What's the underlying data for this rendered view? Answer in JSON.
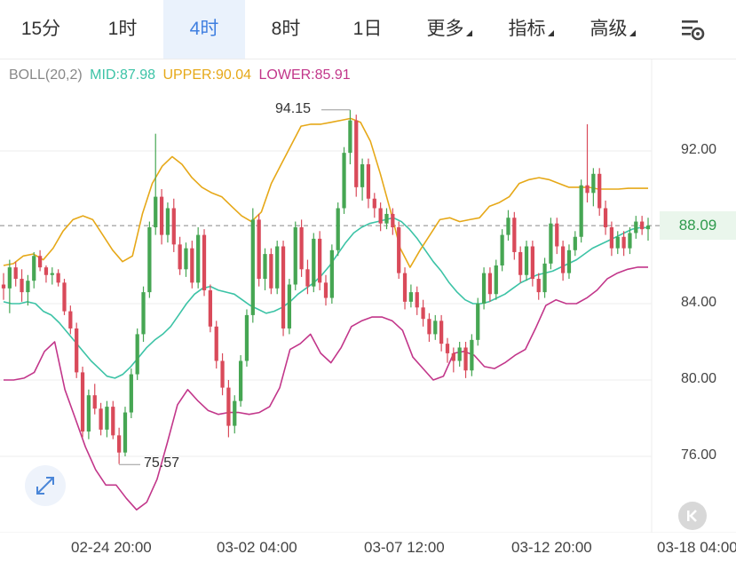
{
  "tabs": [
    {
      "label": "15分",
      "active": false,
      "dropdown": false
    },
    {
      "label": "1时",
      "active": false,
      "dropdown": false
    },
    {
      "label": "4时",
      "active": true,
      "dropdown": false
    },
    {
      "label": "8时",
      "active": false,
      "dropdown": false
    },
    {
      "label": "1日",
      "active": false,
      "dropdown": false
    },
    {
      "label": "更多",
      "active": false,
      "dropdown": true
    },
    {
      "label": "指标",
      "active": false,
      "dropdown": true
    },
    {
      "label": "高级",
      "active": false,
      "dropdown": true
    }
  ],
  "toolbar": {
    "settings_icon": "chart-settings-icon"
  },
  "indicator": {
    "name": "BOLL(20,2)",
    "mid": "MID:87.98",
    "upper": "UPPER:90.04",
    "lower": "LOWER:85.91",
    "colors": {
      "name": "#888888",
      "mid": "#3cc3a6",
      "upper": "#e6a818",
      "lower": "#c2368a"
    }
  },
  "price_axis": [
    "92.00",
    "88.09",
    "84.00",
    "80.00",
    "76.00"
  ],
  "last_price": "88.09",
  "time_axis": [
    "02-24 20:00",
    "03-02 04:00",
    "03-07 12:00",
    "03-12 20:00",
    "03-18 04:00"
  ],
  "high_label": "94.15",
  "low_label": "75.57",
  "buttons": {
    "expand_icon": "expand-icon",
    "reset_icon": "chevron-left-icon"
  },
  "chart_data": {
    "type": "candlestick",
    "ylim": [
      73,
      97
    ],
    "yticks": [
      76,
      80,
      84,
      88,
      92
    ],
    "xlabels": [
      "02-24 20:00",
      "03-02 04:00",
      "03-07 12:00",
      "03-12 20:00",
      "03-18 04:00"
    ],
    "up_color": "#46a653",
    "down_color": "#d94a5a",
    "last_price": 88.09,
    "high": 94.15,
    "low": 75.57,
    "candles": [
      [
        85.0,
        85.6,
        84.2,
        84.8
      ],
      [
        84.8,
        86.3,
        83.5,
        85.9
      ],
      [
        85.9,
        86.2,
        84.9,
        85.3
      ],
      [
        85.3,
        85.8,
        84.1,
        84.6
      ],
      [
        84.6,
        85.5,
        83.9,
        85.2
      ],
      [
        85.2,
        86.7,
        84.8,
        86.5
      ],
      [
        86.5,
        86.8,
        85.7,
        85.9
      ],
      [
        85.9,
        86.0,
        85.1,
        85.5
      ],
      [
        85.5,
        85.9,
        85.0,
        85.6
      ],
      [
        85.6,
        85.8,
        84.9,
        85.1
      ],
      [
        85.1,
        85.3,
        83.4,
        83.6
      ],
      [
        83.6,
        83.9,
        82.4,
        82.7
      ],
      [
        82.7,
        83.0,
        80.1,
        80.4
      ],
      [
        80.4,
        80.7,
        77.0,
        77.3
      ],
      [
        77.3,
        79.5,
        76.9,
        79.2
      ],
      [
        79.2,
        79.8,
        78.2,
        78.5
      ],
      [
        78.5,
        78.8,
        77.1,
        77.4
      ],
      [
        77.4,
        78.9,
        77.0,
        78.6
      ],
      [
        78.6,
        78.9,
        76.9,
        77.1
      ],
      [
        77.1,
        77.5,
        75.6,
        76.2
      ],
      [
        76.2,
        78.6,
        76.0,
        78.3
      ],
      [
        78.3,
        80.6,
        78.0,
        80.3
      ],
      [
        80.3,
        82.7,
        80.0,
        82.4
      ],
      [
        82.4,
        84.9,
        82.0,
        84.6
      ],
      [
        84.6,
        88.3,
        84.3,
        88.0
      ],
      [
        88.0,
        92.9,
        87.6,
        89.6
      ],
      [
        89.6,
        90.0,
        87.1,
        87.6
      ],
      [
        87.6,
        89.3,
        87.2,
        89.0
      ],
      [
        89.0,
        89.5,
        86.7,
        87.1
      ],
      [
        87.1,
        87.5,
        85.5,
        85.8
      ],
      [
        85.8,
        87.2,
        85.4,
        86.9
      ],
      [
        86.9,
        87.3,
        84.8,
        85.1
      ],
      [
        85.1,
        88.0,
        84.8,
        87.6
      ],
      [
        87.6,
        87.9,
        84.4,
        84.7
      ],
      [
        84.7,
        85.0,
        82.5,
        82.8
      ],
      [
        82.8,
        83.1,
        80.6,
        81.0
      ],
      [
        81.0,
        81.4,
        79.2,
        79.6
      ],
      [
        79.6,
        80.0,
        77.0,
        77.6
      ],
      [
        77.6,
        79.2,
        77.2,
        78.9
      ],
      [
        78.9,
        81.3,
        78.6,
        81.0
      ],
      [
        81.0,
        83.7,
        80.7,
        83.4
      ],
      [
        83.4,
        89.0,
        83.0,
        88.4
      ],
      [
        88.4,
        88.7,
        84.9,
        85.3
      ],
      [
        85.3,
        86.9,
        84.7,
        86.6
      ],
      [
        86.6,
        86.9,
        84.5,
        84.8
      ],
      [
        84.8,
        87.3,
        84.5,
        87.0
      ],
      [
        87.0,
        87.3,
        82.3,
        82.7
      ],
      [
        82.7,
        85.3,
        82.4,
        85.0
      ],
      [
        85.0,
        88.3,
        84.7,
        88.0
      ],
      [
        88.0,
        88.4,
        85.4,
        85.8
      ],
      [
        85.8,
        86.3,
        84.5,
        84.9
      ],
      [
        84.9,
        87.7,
        84.6,
        87.4
      ],
      [
        87.4,
        87.8,
        84.7,
        85.1
      ],
      [
        85.1,
        85.5,
        83.9,
        84.3
      ],
      [
        84.3,
        87.1,
        84.0,
        86.8
      ],
      [
        86.8,
        89.3,
        86.5,
        89.0
      ],
      [
        89.0,
        92.2,
        88.7,
        91.9
      ],
      [
        91.9,
        94.15,
        91.3,
        93.6
      ],
      [
        93.6,
        93.9,
        89.6,
        90.1
      ],
      [
        90.1,
        91.6,
        89.4,
        91.3
      ],
      [
        91.3,
        91.6,
        89.0,
        89.5
      ],
      [
        89.5,
        89.8,
        88.5,
        89.0
      ],
      [
        89.0,
        89.3,
        87.8,
        88.2
      ],
      [
        88.2,
        89.0,
        87.9,
        88.7
      ],
      [
        88.7,
        89.0,
        87.6,
        88.0
      ],
      [
        88.0,
        88.3,
        85.3,
        85.6
      ],
      [
        85.6,
        85.9,
        83.7,
        84.1
      ],
      [
        84.1,
        85.0,
        83.8,
        84.6
      ],
      [
        84.6,
        84.9,
        83.4,
        83.8
      ],
      [
        83.8,
        84.2,
        82.8,
        83.2
      ],
      [
        83.2,
        83.5,
        82.0,
        82.4
      ],
      [
        82.4,
        83.4,
        82.1,
        83.1
      ],
      [
        83.1,
        83.4,
        81.5,
        81.9
      ],
      [
        81.9,
        82.2,
        80.9,
        81.4
      ],
      [
        81.4,
        81.7,
        80.4,
        81.0
      ],
      [
        81.0,
        82.0,
        80.7,
        81.7
      ],
      [
        81.7,
        82.0,
        80.1,
        80.5
      ],
      [
        80.5,
        82.4,
        80.2,
        82.1
      ],
      [
        82.1,
        84.3,
        81.8,
        84.0
      ],
      [
        84.0,
        85.9,
        83.7,
        85.6
      ],
      [
        85.6,
        85.9,
        84.1,
        84.5
      ],
      [
        84.5,
        86.3,
        84.2,
        86.0
      ],
      [
        86.0,
        87.9,
        85.7,
        87.6
      ],
      [
        87.6,
        88.9,
        87.3,
        88.5
      ],
      [
        88.5,
        88.8,
        86.3,
        86.7
      ],
      [
        86.7,
        87.0,
        85.1,
        85.5
      ],
      [
        85.5,
        87.3,
        85.2,
        87.0
      ],
      [
        87.0,
        87.3,
        84.9,
        85.3
      ],
      [
        85.3,
        85.6,
        84.2,
        84.6
      ],
      [
        84.6,
        86.4,
        84.3,
        86.1
      ],
      [
        86.1,
        88.5,
        85.8,
        88.2
      ],
      [
        88.2,
        88.5,
        86.6,
        87.0
      ],
      [
        87.0,
        87.3,
        85.2,
        85.6
      ],
      [
        85.6,
        87.1,
        85.3,
        86.8
      ],
      [
        86.8,
        87.8,
        86.5,
        87.5
      ],
      [
        87.5,
        90.5,
        87.2,
        90.2
      ],
      [
        90.2,
        93.4,
        89.3,
        89.8
      ],
      [
        89.8,
        91.1,
        89.1,
        90.8
      ],
      [
        90.8,
        91.1,
        88.6,
        89.0
      ],
      [
        89.0,
        89.4,
        87.6,
        88.0
      ],
      [
        88.0,
        88.3,
        86.5,
        86.9
      ],
      [
        86.9,
        87.8,
        86.6,
        87.5
      ],
      [
        87.5,
        87.8,
        86.5,
        86.9
      ],
      [
        86.9,
        88.0,
        86.6,
        87.7
      ],
      [
        87.7,
        88.6,
        87.4,
        88.3
      ],
      [
        88.3,
        88.6,
        87.6,
        87.9
      ],
      [
        87.9,
        88.5,
        87.3,
        88.09
      ]
    ],
    "series": [
      {
        "name": "MID",
        "color": "#3cc3a6",
        "values": [
          84.1,
          84.0,
          84.0,
          84.1,
          84.0,
          83.6,
          83.4,
          83.0,
          82.5,
          82.0,
          81.5,
          81.0,
          80.6,
          80.2,
          80.1,
          80.3,
          80.7,
          81.2,
          81.7,
          82.1,
          82.4,
          82.8,
          83.4,
          84.0,
          84.5,
          84.8,
          84.9,
          84.7,
          84.6,
          84.5,
          84.2,
          83.9,
          83.7,
          83.5,
          83.6,
          83.8,
          84.1,
          84.5,
          84.8,
          85.1,
          85.5,
          86.0,
          86.6,
          87.2,
          87.7,
          88.0,
          88.2,
          88.3,
          88.4,
          88.5,
          88.3,
          87.9,
          87.4,
          86.8,
          86.2,
          85.7,
          85.1,
          84.6,
          84.2,
          84.0,
          84.0,
          84.1,
          84.3,
          84.5,
          84.8,
          85.1,
          85.3,
          85.5,
          85.6,
          85.7,
          85.9,
          86.1,
          86.3,
          86.6,
          86.9,
          87.1,
          87.3,
          87.5,
          87.7,
          87.9,
          87.98,
          87.98
        ]
      },
      {
        "name": "UPPER",
        "color": "#e6a818",
        "values": [
          86.0,
          86.1,
          86.5,
          86.6,
          86.3,
          86.9,
          87.8,
          88.4,
          88.6,
          88.4,
          87.6,
          86.8,
          86.2,
          86.5,
          88.7,
          90.3,
          91.2,
          91.7,
          91.3,
          90.6,
          90.1,
          89.8,
          89.6,
          89.1,
          88.6,
          88.3,
          88.8,
          90.3,
          91.3,
          92.3,
          93.3,
          93.4,
          93.4,
          93.5,
          93.6,
          93.7,
          93.5,
          92.5,
          90.8,
          88.9,
          86.9,
          85.9,
          86.8,
          87.6,
          88.4,
          88.5,
          88.3,
          88.4,
          88.5,
          89.1,
          89.3,
          89.6,
          90.3,
          90.5,
          90.6,
          90.5,
          90.3,
          90.1,
          90.1,
          90.1,
          90.0,
          90.0,
          90.0,
          90.04,
          90.04,
          90.04
        ]
      },
      {
        "name": "LOWER",
        "color": "#c2368a",
        "values": [
          80.0,
          80.0,
          80.1,
          80.4,
          81.5,
          82.0,
          79.5,
          78.0,
          76.5,
          75.3,
          74.5,
          74.5,
          73.8,
          73.2,
          73.6,
          74.8,
          76.7,
          78.7,
          79.5,
          78.9,
          78.4,
          78.2,
          78.3,
          78.3,
          78.2,
          78.3,
          78.6,
          79.6,
          81.6,
          81.9,
          82.4,
          81.4,
          80.9,
          81.7,
          82.8,
          83.1,
          83.3,
          83.3,
          83.1,
          82.6,
          81.2,
          80.6,
          80.0,
          80.2,
          81.4,
          81.5,
          81.3,
          80.7,
          80.6,
          80.9,
          81.3,
          81.6,
          82.7,
          83.9,
          84.2,
          84.0,
          84.0,
          84.3,
          84.7,
          85.3,
          85.6,
          85.8,
          85.91,
          85.91
        ]
      }
    ]
  }
}
